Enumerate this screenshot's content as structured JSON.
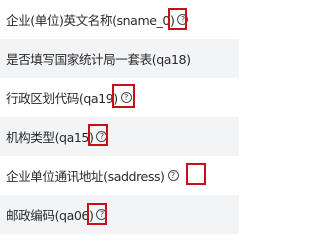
{
  "fields": [
    {
      "label": "企业(单位)英文名称(sname_0)",
      "has_help": true
    },
    {
      "label": "是否填写国家统计局一套表(qa18)",
      "has_help": false
    },
    {
      "label": "行政区划代码(qa19)",
      "has_help": true
    },
    {
      "label": "机构类型(qa15)",
      "has_help": true
    },
    {
      "label": "企业单位通讯地址(saddress)",
      "has_help": true
    },
    {
      "label": "邮政编码(qa06)",
      "has_help": true
    }
  ],
  "help_glyph": "?",
  "help_icon_name": "question-circle-icon",
  "highlight_color": "#c8101a"
}
